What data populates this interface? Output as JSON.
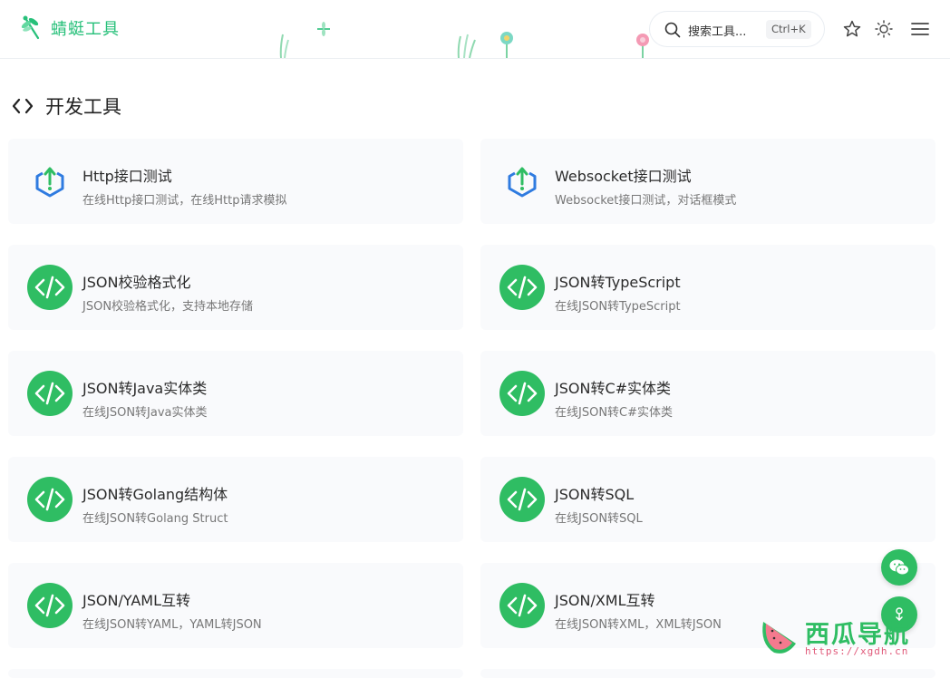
{
  "header": {
    "logo_text": "蜻蜓工具",
    "search_placeholder": "搜索工具...",
    "search_shortcut": "Ctrl+K",
    "brand_color": "#27c07a"
  },
  "section": {
    "title": "开发工具"
  },
  "cards": [
    {
      "title": "Http接口测试",
      "desc": "在线Http接口测试，在线Http请求模拟",
      "icon": "upload-box-icon"
    },
    {
      "title": "Websocket接口测试",
      "desc": "Websocket接口测试，对话框模式",
      "icon": "upload-box-icon"
    },
    {
      "title": "JSON校验格式化",
      "desc": "JSON校验格式化，支持本地存储",
      "icon": "code-icon"
    },
    {
      "title": "JSON转TypeScript",
      "desc": "在线JSON转TypeScript",
      "icon": "code-icon"
    },
    {
      "title": "JSON转Java实体类",
      "desc": "在线JSON转Java实体类",
      "icon": "code-icon"
    },
    {
      "title": "JSON转C#实体类",
      "desc": "在线JSON转C#实体类",
      "icon": "code-icon"
    },
    {
      "title": "JSON转Golang结构体",
      "desc": "在线JSON转Golang Struct",
      "icon": "code-icon"
    },
    {
      "title": "JSON转SQL",
      "desc": "在线JSON转SQL",
      "icon": "code-icon"
    },
    {
      "title": "JSON/YAML互转",
      "desc": "在线JSON转YAML，YAML转JSON",
      "icon": "code-icon"
    },
    {
      "title": "JSON/XML互转",
      "desc": "在线JSON转XML，XML转JSON",
      "icon": "code-icon"
    }
  ],
  "watermark": {
    "text": "西瓜导航",
    "url": "https://xgdh.cn"
  },
  "colors": {
    "accent_green": "#2fbd63",
    "upload_icon_blue": "#2f7be0"
  }
}
